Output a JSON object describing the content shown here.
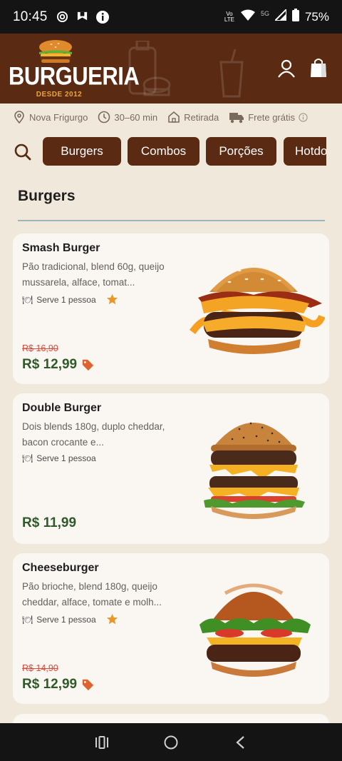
{
  "status_bar": {
    "time": "10:45",
    "network_label": "5G",
    "lte_label": "Vo LTE",
    "battery": "75%",
    "icons": [
      "hotspot-icon",
      "app-notification-icon",
      "info-icon",
      "wifi-icon",
      "signal-icon",
      "battery-icon"
    ]
  },
  "header": {
    "logo_text": "BURGUERIA",
    "logo_since": "DESDE 2012",
    "icons": [
      "user-icon",
      "shopping-bag-icon"
    ]
  },
  "info_bar": {
    "location": "Nova Frigurgo",
    "time": "30–60 min",
    "pickup": "Retirada",
    "shipping": "Frete grátis"
  },
  "categories": [
    "Burgers",
    "Combos",
    "Porções",
    "Hotdogs"
  ],
  "section_title": "Burgers",
  "products": [
    {
      "name": "Smash Burger",
      "description": "Pão tradicional, blend 60g, queijo mussarela, alface, tomat...",
      "serves": "Serve 1 pessoa",
      "featured": true,
      "old_price": "R$ 16,90",
      "price": "R$ 12,99",
      "on_sale": true
    },
    {
      "name": "Double Burger",
      "description": "Dois blends 180g, duplo cheddar, bacon crocante e...",
      "serves": "Serve 1 pessoa",
      "featured": false,
      "old_price": "",
      "price": "R$ 11,99",
      "on_sale": false
    },
    {
      "name": "Cheeseburger",
      "description": "Pão brioche, blend 180g, queijo cheddar, alface, tomate e molh...",
      "serves": "Serve 1 pessoa",
      "featured": true,
      "old_price": "R$ 14,90",
      "price": "R$ 12,99",
      "on_sale": true
    }
  ],
  "colors": {
    "brand_brown": "#5a2a12",
    "price_green": "#2f5a2a",
    "old_price_red": "#d94b3a",
    "star_orange": "#e9972b",
    "background": "#f1e8dc"
  },
  "nav_bar": {
    "icons": [
      "recent-apps-icon",
      "home-icon",
      "back-icon"
    ]
  }
}
